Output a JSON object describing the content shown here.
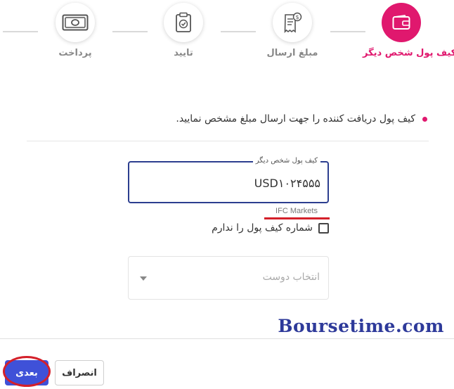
{
  "stepper": {
    "steps": [
      {
        "label": "کیف پول شخص دیگر",
        "icon": "wallet-icon",
        "active": true
      },
      {
        "label": "مبلغ ارسال",
        "icon": "invoice-icon",
        "active": false
      },
      {
        "label": "تایید",
        "icon": "clipboard-check-icon",
        "active": false
      },
      {
        "label": "پرداخت",
        "icon": "banknote-icon",
        "active": false
      }
    ]
  },
  "form": {
    "instruction": "کیف پول دریافت کننده را جهت ارسال مبلغ مشخص نمایید.",
    "wallet_label": "کیف پول شخص دیگر",
    "wallet_value": "USD۱۰۲۴۵۵۵",
    "wallet_helper": "IFC Markets",
    "no_wallet_label": "شماره کیف پول را ندارم",
    "friend_select_placeholder": "انتخاب دوست"
  },
  "watermark": "Boursetime.com",
  "footer": {
    "next_label": "بعدی",
    "cancel_label": "انصراف"
  },
  "colors": {
    "accent": "#e0186e",
    "primary_button": "#3f51d8",
    "field_border": "#2c3e8f",
    "highlight_red": "#d4202a"
  }
}
